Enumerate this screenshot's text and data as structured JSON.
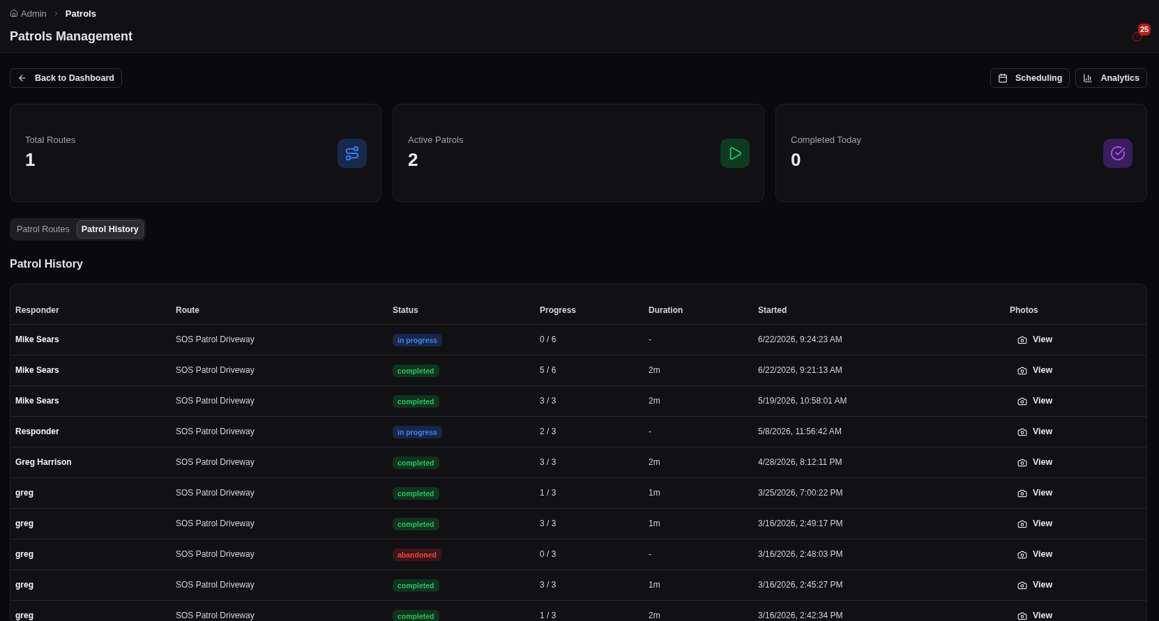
{
  "breadcrumb": [
    {
      "label": "Admin",
      "current": false
    },
    {
      "label": "Patrols",
      "current": true
    }
  ],
  "page_title": "Patrols Management",
  "notifications": {
    "count": "25"
  },
  "back_button": "Back to Dashboard",
  "actions": [
    {
      "label": "Scheduling"
    },
    {
      "label": "Analytics"
    }
  ],
  "stats": [
    {
      "label": "Total Routes",
      "value": "1",
      "kind": "routes"
    },
    {
      "label": "Active Patrols",
      "value": "2",
      "kind": "active"
    },
    {
      "label": "Completed Today",
      "value": "0",
      "kind": "completed"
    }
  ],
  "tabs": [
    {
      "label": "Patrol Routes",
      "selected": false
    },
    {
      "label": "Patrol History",
      "selected": true
    }
  ],
  "history": {
    "title": "Patrol History",
    "columns": [
      "Responder",
      "Route",
      "Status",
      "Progress",
      "Duration",
      "Started",
      "Photos"
    ],
    "rows": [
      {
        "responder": "Mike Sears",
        "route": "SOS Patrol Driveway",
        "status": {
          "label": "in progress",
          "kind": "ongoing"
        },
        "progress": "0 / 6",
        "duration": "-",
        "started": "6/22/2026, 9:24:23 AM",
        "photos": "View"
      },
      {
        "responder": "Mike Sears",
        "route": "SOS Patrol Driveway",
        "status": {
          "label": "completed",
          "kind": "done"
        },
        "progress": "5 / 6",
        "duration": "2m",
        "started": "6/22/2026, 9:21:13 AM",
        "photos": "View"
      },
      {
        "responder": "Mike Sears",
        "route": "SOS Patrol Driveway",
        "status": {
          "label": "completed",
          "kind": "done"
        },
        "progress": "3 / 3",
        "duration": "2m",
        "started": "5/19/2026, 10:58:01 AM",
        "photos": "View"
      },
      {
        "responder": "Responder",
        "route": "SOS Patrol Driveway",
        "status": {
          "label": "in progress",
          "kind": "ongoing"
        },
        "progress": "2 / 3",
        "duration": "-",
        "started": "5/8/2026, 11:56:42 AM",
        "photos": "View"
      },
      {
        "responder": "Greg Harrison",
        "route": "SOS Patrol Driveway",
        "status": {
          "label": "completed",
          "kind": "done"
        },
        "progress": "3 / 3",
        "duration": "2m",
        "started": "4/28/2026, 8:12:11 PM",
        "photos": "View"
      },
      {
        "responder": "greg",
        "route": "SOS Patrol Driveway",
        "status": {
          "label": "completed",
          "kind": "done"
        },
        "progress": "1 / 3",
        "duration": "1m",
        "started": "3/25/2026, 7:00:22 PM",
        "photos": "View"
      },
      {
        "responder": "greg",
        "route": "SOS Patrol Driveway",
        "status": {
          "label": "completed",
          "kind": "done"
        },
        "progress": "3 / 3",
        "duration": "1m",
        "started": "3/16/2026, 2:49:17 PM",
        "photos": "View"
      },
      {
        "responder": "greg",
        "route": "SOS Patrol Driveway",
        "status": {
          "label": "abandoned",
          "kind": "abandoned"
        },
        "progress": "0 / 3",
        "duration": "-",
        "started": "3/16/2026, 2:48:03 PM",
        "photos": "View"
      },
      {
        "responder": "greg",
        "route": "SOS Patrol Driveway",
        "status": {
          "label": "completed",
          "kind": "done"
        },
        "progress": "3 / 3",
        "duration": "1m",
        "started": "3/16/2026, 2:45:27 PM",
        "photos": "View"
      },
      {
        "responder": "greg",
        "route": "SOS Patrol Driveway",
        "status": {
          "label": "completed",
          "kind": "done"
        },
        "progress": "1 / 3",
        "duration": "2m",
        "started": "3/16/2026, 2:42:34 PM",
        "photos": "View"
      }
    ]
  }
}
